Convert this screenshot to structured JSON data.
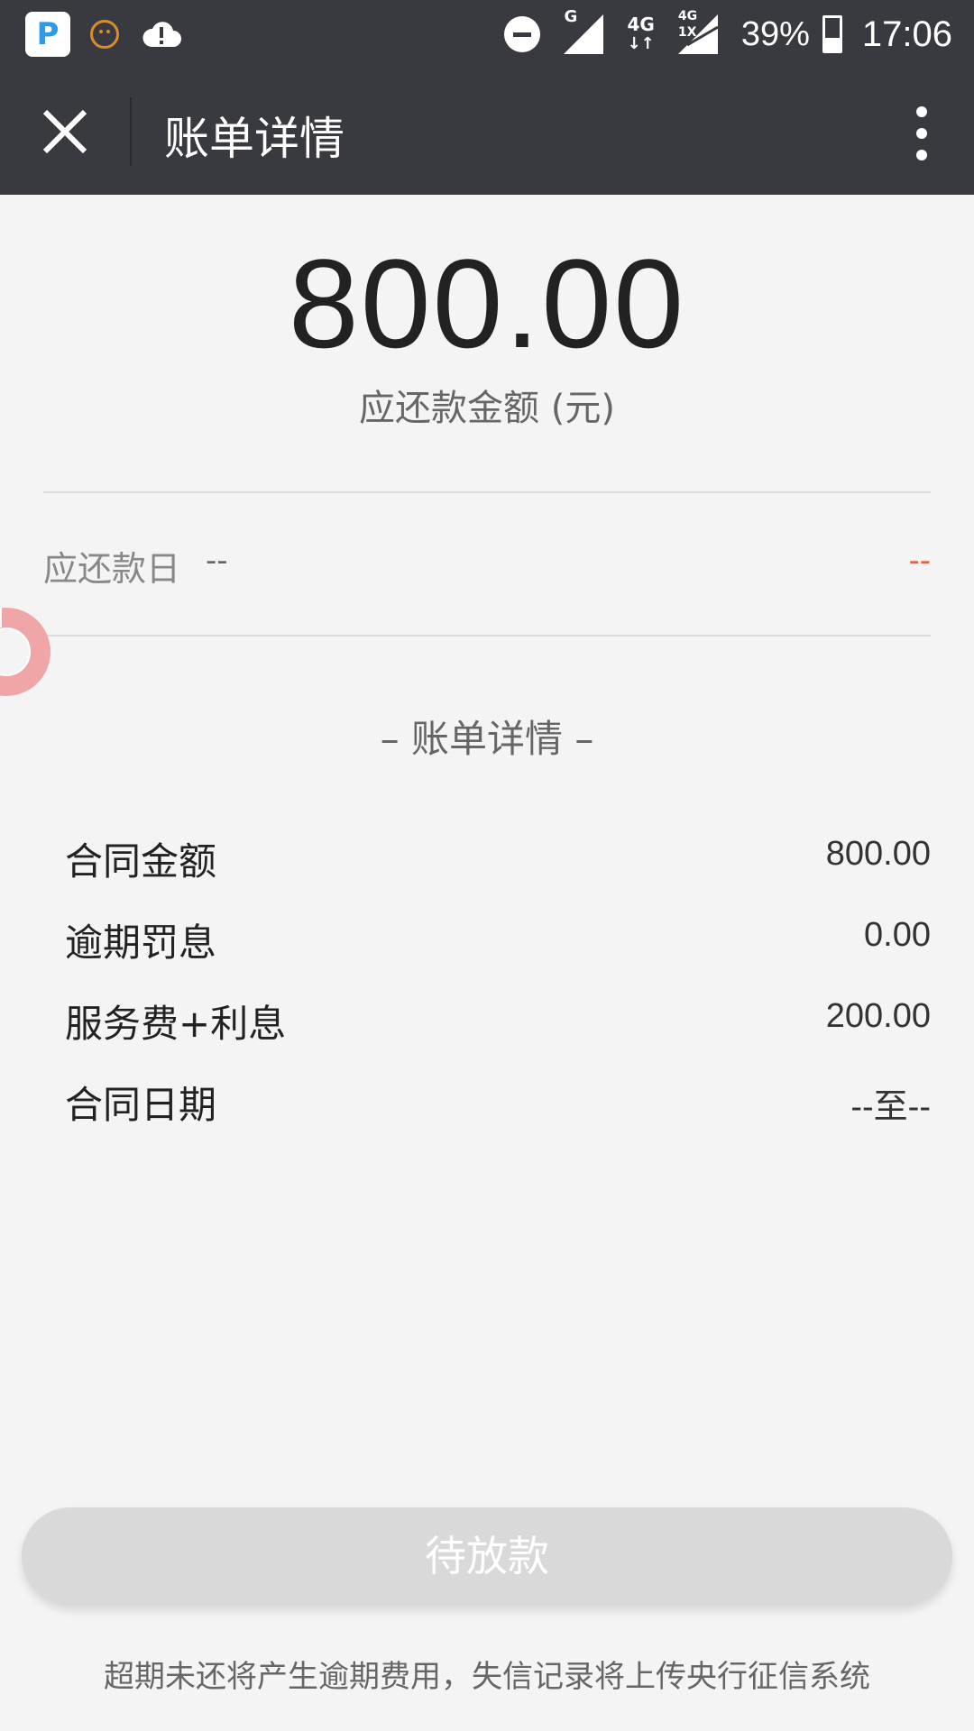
{
  "status_bar": {
    "battery_percent": "39%",
    "battery_level": 0.39,
    "time": "17:06",
    "network_g": "G",
    "network_4g": "4G",
    "network_4g_small": "4G",
    "network_1x": "1X"
  },
  "header": {
    "title": "账单详情"
  },
  "amount": {
    "value": "800.00",
    "label": "应还款金额 (元)"
  },
  "due": {
    "label": "应还款日",
    "date": "--",
    "status": "--"
  },
  "section_title": "– 账单详情 –",
  "details": [
    {
      "label": "合同金额",
      "value": "800.00"
    },
    {
      "label": "逾期罚息",
      "value": "0.00"
    },
    {
      "label": "服务费+利息",
      "value": "200.00"
    },
    {
      "label": "合同日期",
      "value": "--至--"
    }
  ],
  "action_button": "待放款",
  "footer_note": "超期未还将产生逾期费用，失信记录将上传央行征信系统",
  "colors": {
    "header_bg": "#393a3f",
    "page_bg": "#f4f4f5",
    "due_status": "#e8643c",
    "button_bg": "#d9d9d9"
  },
  "icons": [
    "app-icon",
    "face-icon",
    "cloud-alert-icon",
    "dnd-icon",
    "signal-icon",
    "battery-icon",
    "close-icon",
    "more-icon",
    "lifebuoy-icon"
  ]
}
